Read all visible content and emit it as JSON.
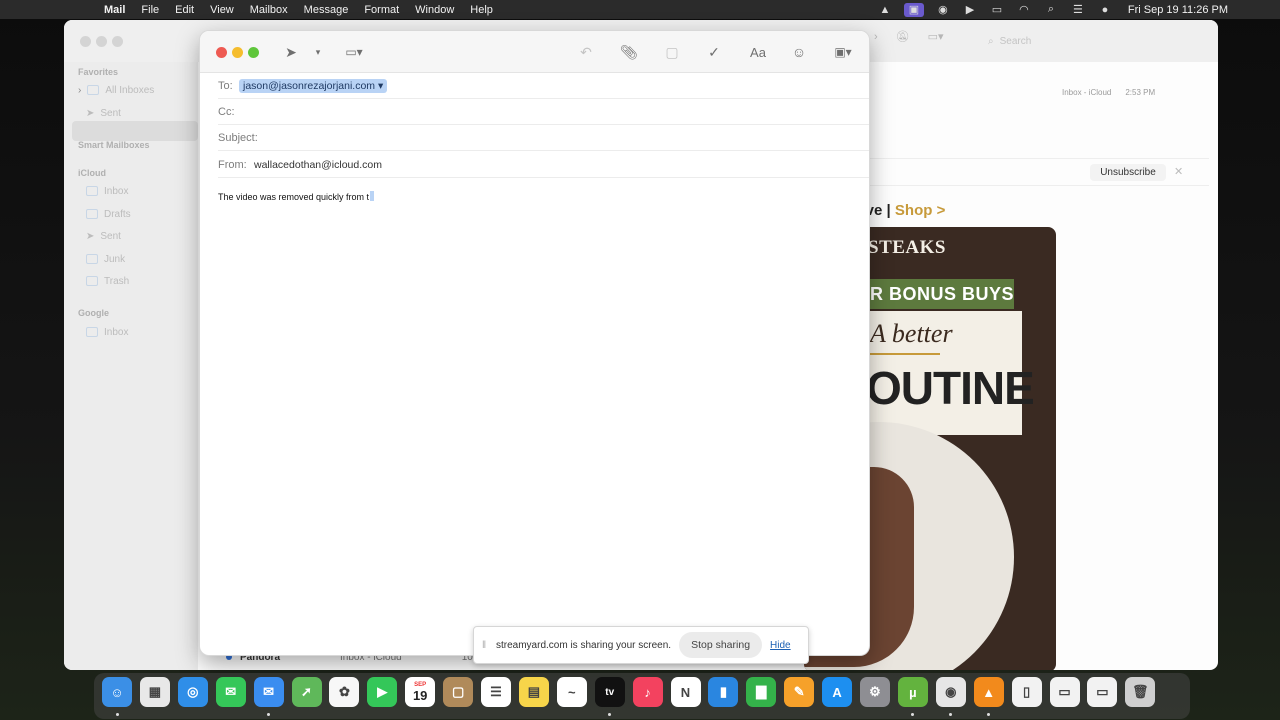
{
  "menubar": {
    "app_name": "Mail",
    "menus": [
      "File",
      "Edit",
      "View",
      "Mailbox",
      "Message",
      "Format",
      "Window",
      "Help"
    ],
    "clock": "Fri Sep 19  11:26 PM"
  },
  "sidebar": {
    "favorites_header": "Favorites",
    "favorites": [
      "All Inboxes",
      "Sent"
    ],
    "smart_header": "Smart Mailboxes",
    "icloud_header": "iCloud",
    "icloud_items": [
      "Inbox",
      "Drafts",
      "Sent",
      "Junk",
      "Trash"
    ],
    "google_header": "Google",
    "google_items": [
      "Inbox"
    ]
  },
  "main_window": {
    "search_placeholder": "Search",
    "message_mailbox": "Inbox - iCloud",
    "message_time": "2:53 PM",
    "unsubscribe_label": "Unsubscribe",
    "promo_prefix": "usive |",
    "promo_shop": "Shop >",
    "promo_brand": "STEAKS",
    "promo_bonus": "R BONUS BUYS",
    "promo_better": "A better",
    "promo_routine": "OUTINE",
    "bottom_sender": "Pandora",
    "bottom_mailbox": "Inbox - iCloud",
    "bottom_time": "10:21"
  },
  "compose": {
    "to_label": "To:",
    "to_value": "jason@jasonrezajorjani.com ▾",
    "cc_label": "Cc:",
    "subject_label": "Subject:",
    "from_label": "From:",
    "from_value": "wallacedothan@icloud.com",
    "body": "The video was removed quickly from t",
    "format_label": "Aa"
  },
  "share_bar": {
    "message": "streamyard.com is sharing your screen.",
    "stop_label": "Stop sharing",
    "hide_label": "Hide"
  },
  "dock": {
    "calendar_day": "19",
    "calendar_month": "SEP",
    "tv_label": "tv",
    "apps": [
      {
        "name": "finder-icon",
        "color": "#3b8fe6"
      },
      {
        "name": "launchpad-icon",
        "color": "#e8e8e8"
      },
      {
        "name": "safari-icon",
        "color": "#2f8ee8"
      },
      {
        "name": "messages-icon",
        "color": "#35c759"
      },
      {
        "name": "mail-icon",
        "color": "#3a8df0"
      },
      {
        "name": "maps-icon",
        "color": "#5fb85a"
      },
      {
        "name": "photos-icon",
        "color": "#f7f7f7"
      },
      {
        "name": "facetime-icon",
        "color": "#34c759"
      },
      {
        "name": "calendar-icon",
        "color": "#ffffff"
      },
      {
        "name": "contacts-icon",
        "color": "#b08a5a"
      },
      {
        "name": "reminders-icon",
        "color": "#ffffff"
      },
      {
        "name": "notes-icon",
        "color": "#f7d54a"
      },
      {
        "name": "freeform-icon",
        "color": "#ffffff"
      },
      {
        "name": "appletv-icon",
        "color": "#111111"
      },
      {
        "name": "music-icon",
        "color": "#f3425f"
      },
      {
        "name": "news-icon",
        "color": "#ffffff"
      },
      {
        "name": "keynote-icon",
        "color": "#2a86e0"
      },
      {
        "name": "numbers-icon",
        "color": "#34b24a"
      },
      {
        "name": "pages-icon",
        "color": "#f6a12a"
      },
      {
        "name": "appstore-icon",
        "color": "#1d8ff0"
      },
      {
        "name": "system-settings-icon",
        "color": "#8e8e93"
      },
      {
        "name": "utorrent-icon",
        "color": "#63b33e"
      },
      {
        "name": "chrome-icon",
        "color": "#e6e6e6"
      },
      {
        "name": "vlc-icon",
        "color": "#f28a1c"
      },
      {
        "name": "document-icon",
        "color": "#f2f2f2"
      },
      {
        "name": "preview-icon",
        "color": "#f2f2f2"
      },
      {
        "name": "screenshot-icon",
        "color": "#f2f2f2"
      },
      {
        "name": "trash-icon",
        "color": "#cfcfcf"
      }
    ]
  },
  "colors": {
    "close": "#ee5a52",
    "minimize": "#f5bd2e",
    "zoom": "#5fc63b",
    "token": "#b9d3f5",
    "link": "#1a5fb4",
    "promo_green": "#5d7a3e",
    "shop_gold": "#c79a3a"
  }
}
